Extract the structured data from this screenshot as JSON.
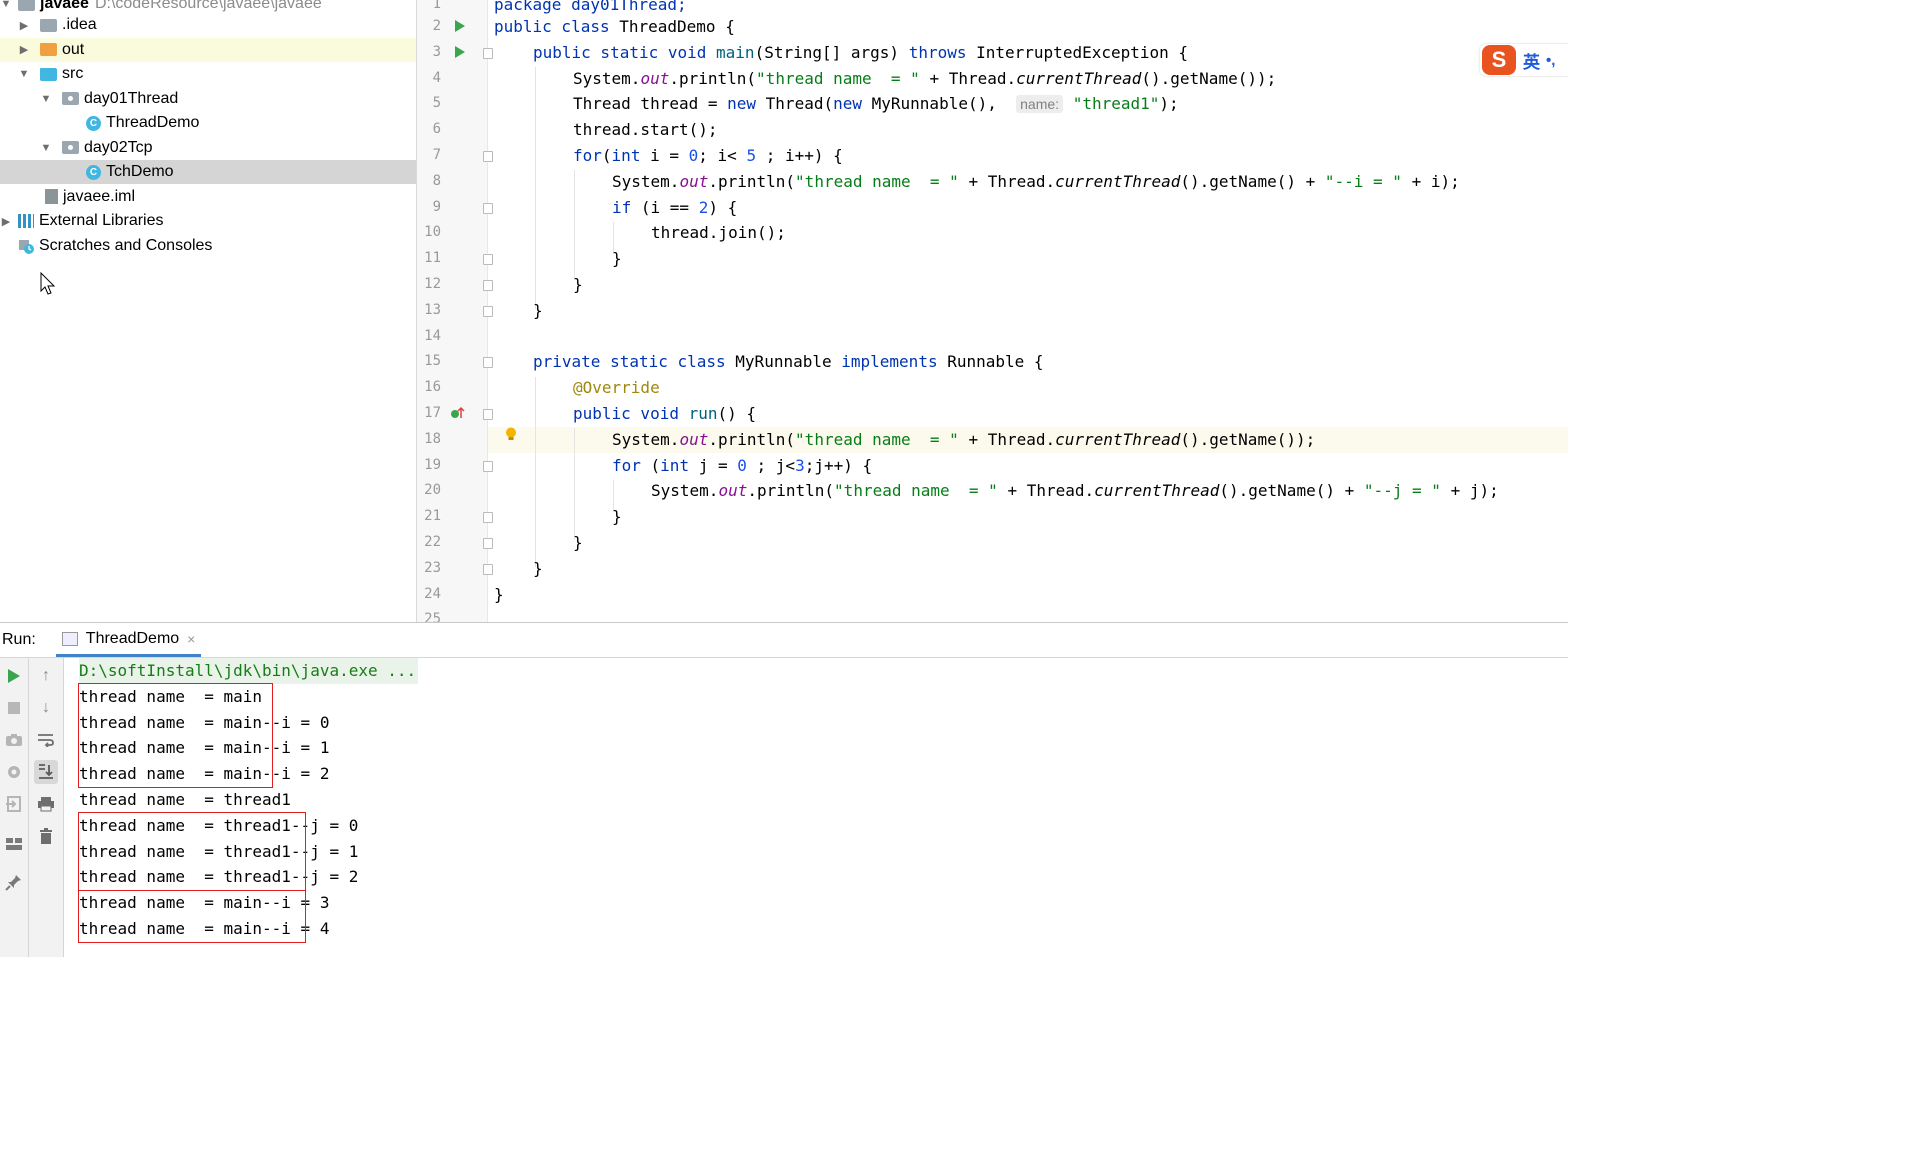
{
  "project_tree": {
    "root": {
      "name": "javaee",
      "path": "D:\\codeResource\\javaee\\javaee"
    },
    "items": [
      {
        "label": ".idea",
        "icon": "folder-icon"
      },
      {
        "label": "out",
        "icon": "folder-excluded-icon"
      },
      {
        "label": "src",
        "icon": "source-folder-icon"
      },
      {
        "label": "day01Thread",
        "icon": "package-icon"
      },
      {
        "label": "ThreadDemo",
        "icon": "java-class-icon"
      },
      {
        "label": "day02Tcp",
        "icon": "package-icon"
      },
      {
        "label": "TchDemo",
        "icon": "java-class-icon"
      },
      {
        "label": "javaee.iml",
        "icon": "module-file-icon"
      },
      {
        "label": "External Libraries",
        "icon": "libraries-icon"
      },
      {
        "label": "Scratches and Consoles",
        "icon": "scratches-icon"
      }
    ]
  },
  "editor": {
    "line_numbers": [
      "1",
      "2",
      "3",
      "4",
      "5",
      "6",
      "7",
      "8",
      "9",
      "10",
      "11",
      "12",
      "13",
      "14",
      "15",
      "16",
      "17",
      "18",
      "19",
      "20",
      "21",
      "22",
      "23",
      "24",
      "25"
    ],
    "param_hint": "name:",
    "code": {
      "l1": "package day01Thread;",
      "l2_kw": "public class",
      "l2_rest": " ThreadDemo {",
      "l3_kw": "public static void",
      "l3_m": " main",
      "l3_a": "(String[] args) ",
      "l3_kw2": "throws",
      "l3_b": " InterruptedException {",
      "l4_a": "System.",
      "l4_f": "out",
      "l4_b": ".println(",
      "l4_s": "\"thread name  = \"",
      "l4_c": " + Thread.",
      "l4_i": "currentThread",
      "l4_d": "().getName());",
      "l5_a": "Thread thread = ",
      "l5_kw": "new",
      "l5_b": " Thread(",
      "l5_kw2": "new",
      "l5_c": " MyRunnable(),  ",
      "l5_s": "\"thread1\"",
      "l5_d": ");",
      "l6": "thread.start();",
      "l7_kw": "for",
      "l7_a": "(",
      "l7_kw2": "int",
      "l7_b": " i = ",
      "l7_n": "0",
      "l7_c": "; i< ",
      "l7_n2": "5",
      "l7_d": " ; i++) {",
      "l8_a": "System.",
      "l8_f": "out",
      "l8_b": ".println(",
      "l8_s": "\"thread name  = \"",
      "l8_c": " + Thread.",
      "l8_i": "currentThread",
      "l8_d": "().getName() + ",
      "l8_s2": "\"--i = \"",
      "l8_e": " + i);",
      "l9_kw": "if",
      "l9_a": " (i == ",
      "l9_n": "2",
      "l9_b": ") {",
      "l10": "thread.join();",
      "brace_close": "}",
      "l15_kw": "private static class",
      "l15_a": " MyRunnable ",
      "l15_kw2": "implements",
      "l15_b": " Runnable {",
      "l16": "@Override",
      "l17_kw": "public void",
      "l17_m": " run",
      "l17_a": "() {",
      "l18_a": "System.",
      "l18_f": "out",
      "l18_b": ".println(",
      "l18_s": "\"thread name  = \"",
      "l18_c": " + Thread.",
      "l18_i": "currentThread",
      "l18_d": "().getName());",
      "l19_kw": "for",
      "l19_a": " (",
      "l19_kw2": "int",
      "l19_b": " j = ",
      "l19_n": "0",
      "l19_c": " ; j<",
      "l19_n2": "3",
      "l19_d": ";j++) {",
      "l20_a": "System.",
      "l20_f": "out",
      "l20_b": ".println(",
      "l20_s": "\"thread name  = \"",
      "l20_c": " + Thread.",
      "l20_i": "currentThread",
      "l20_d": "().getName() + ",
      "l20_s2": "\"--j = \"",
      "l20_e": " + j);"
    }
  },
  "ime": {
    "logo": "S",
    "mode": "英",
    "punct": "•,"
  },
  "run_panel": {
    "label": "Run:",
    "tab": "ThreadDemo",
    "close": "×",
    "command": "D:\\softInstall\\jdk\\bin\\java.exe ...",
    "output": [
      "thread name  = main",
      "thread name  = main--i = 0",
      "thread name  = main--i = 1",
      "thread name  = main--i = 2",
      "thread name  = thread1",
      "thread name  = thread1--j = 0",
      "thread name  = thread1--j = 1",
      "thread name  = thread1--j = 2",
      "thread name  = main--i = 3",
      "thread name  = main--i = 4"
    ]
  },
  "colors": {
    "keyword": "#0033b3",
    "string": "#067d17",
    "number": "#1750eb",
    "field": "#871094",
    "annotation": "#9e880d",
    "run_green": "#3aa54f",
    "highlight_box": "#e02020"
  }
}
